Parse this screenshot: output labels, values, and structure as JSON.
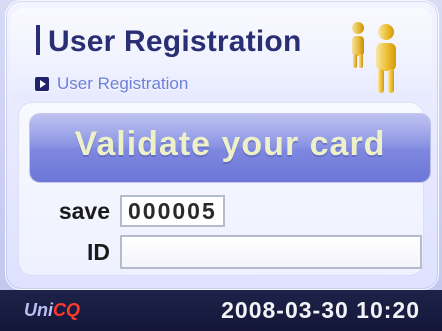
{
  "header": {
    "title": "User Registration",
    "breadcrumb": "User Registration",
    "icon": "users-icon"
  },
  "banner": {
    "text": "Validate your card"
  },
  "form": {
    "save_label": "save",
    "save_value": "000005",
    "id_label": "ID",
    "id_value": ""
  },
  "footer": {
    "brand_part1": "Uni",
    "brand_part2": "CQ",
    "datetime": "2008-03-30 10:20"
  },
  "colors": {
    "title": "#2a2f74",
    "breadcrumb": "#6c80d8",
    "banner": "#7d87df",
    "footer_bg": "#1e2248",
    "brand_accent": "#ff3a2a"
  }
}
